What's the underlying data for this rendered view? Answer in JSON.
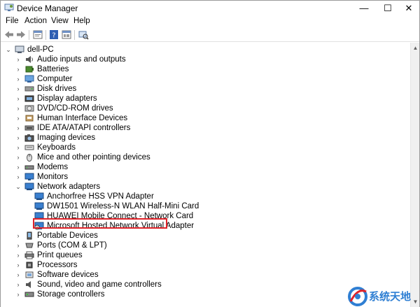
{
  "window": {
    "title": "Device Manager",
    "min_glyph": "—",
    "max_glyph": "☐",
    "close_glyph": "✕"
  },
  "menu": [
    "File",
    "Action",
    "View",
    "Help"
  ],
  "toolbar": {
    "icons": [
      "back-arrow-icon",
      "forward-arrow-icon",
      "properties-icon",
      "help-icon",
      "view-icon",
      "scan-hardware-icon"
    ]
  },
  "tree": {
    "root": "dell-PC",
    "categories": [
      {
        "label": "Audio inputs and outputs",
        "icon": "speaker-icon",
        "expanded": false
      },
      {
        "label": "Batteries",
        "icon": "battery-icon",
        "expanded": false
      },
      {
        "label": "Computer",
        "icon": "computer-icon",
        "expanded": false
      },
      {
        "label": "Disk drives",
        "icon": "disk-drive-icon",
        "expanded": false
      },
      {
        "label": "Display adapters",
        "icon": "display-adapter-icon",
        "expanded": false
      },
      {
        "label": "DVD/CD-ROM drives",
        "icon": "dvd-drive-icon",
        "expanded": false
      },
      {
        "label": "Human Interface Devices",
        "icon": "hid-icon",
        "expanded": false
      },
      {
        "label": "IDE ATA/ATAPI controllers",
        "icon": "ide-controller-icon",
        "expanded": false
      },
      {
        "label": "Imaging devices",
        "icon": "camera-icon",
        "expanded": false
      },
      {
        "label": "Keyboards",
        "icon": "keyboard-icon",
        "expanded": false
      },
      {
        "label": "Mice and other pointing devices",
        "icon": "mouse-icon",
        "expanded": false
      },
      {
        "label": "Modems",
        "icon": "modem-icon",
        "expanded": false
      },
      {
        "label": "Monitors",
        "icon": "monitor-icon",
        "expanded": false
      },
      {
        "label": "Network adapters",
        "icon": "network-adapter-icon",
        "expanded": true
      },
      {
        "label": "Portable Devices",
        "icon": "portable-device-icon",
        "expanded": false
      },
      {
        "label": "Ports (COM & LPT)",
        "icon": "port-icon",
        "expanded": false
      },
      {
        "label": "Print queues",
        "icon": "printer-icon",
        "expanded": false
      },
      {
        "label": "Processors",
        "icon": "processor-icon",
        "expanded": false
      },
      {
        "label": "Software devices",
        "icon": "software-device-icon",
        "expanded": false
      },
      {
        "label": "Sound, video and game controllers",
        "icon": "sound-icon",
        "expanded": false
      },
      {
        "label": "Storage controllers",
        "icon": "storage-controller-icon",
        "expanded": false
      }
    ],
    "network_children": [
      {
        "label": "Anchorfree HSS VPN Adapter",
        "highlighted": false
      },
      {
        "label": "DW1501 Wireless-N WLAN Half-Mini Card",
        "highlighted": false
      },
      {
        "label": "HUAWEI Mobile Connect - Network Card",
        "highlighted": false
      },
      {
        "label": "Microsoft Hosted Network Virtual Adapter",
        "highlighted": true
      }
    ]
  },
  "colors": {
    "highlight_border": "#e0232a",
    "icon_blue": "#2f7fd3"
  },
  "watermark": {
    "text": "系统天地"
  }
}
